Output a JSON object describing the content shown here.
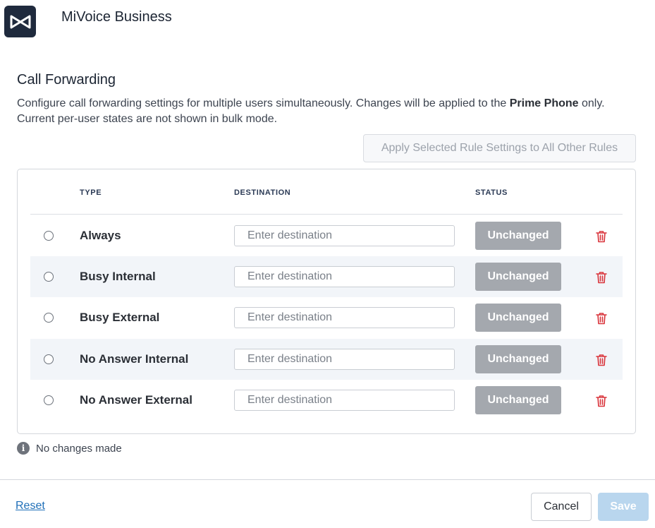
{
  "app": {
    "title": "MiVoice Business",
    "logo_icon": "mitel-logo-icon"
  },
  "section": {
    "title": "Call Forwarding",
    "description_part1": "Configure call forwarding settings for multiple users simultaneously. Changes will be applied to the ",
    "description_bold": "Prime Phone",
    "description_part2": " only. Current per-user states are not shown in bulk mode."
  },
  "apply_all_label": "Apply Selected Rule Settings to All Other Rules",
  "table": {
    "headers": {
      "type": "TYPE",
      "destination": "DESTINATION",
      "status": "STATUS"
    },
    "rows": [
      {
        "type": "Always",
        "destination_value": "",
        "destination_placeholder": "Enter destination",
        "status": "Unchanged"
      },
      {
        "type": "Busy Internal",
        "destination_value": "",
        "destination_placeholder": "Enter destination",
        "status": "Unchanged"
      },
      {
        "type": "Busy External",
        "destination_value": "",
        "destination_placeholder": "Enter destination",
        "status": "Unchanged"
      },
      {
        "type": "No Answer Internal",
        "destination_value": "",
        "destination_placeholder": "Enter destination",
        "status": "Unchanged"
      },
      {
        "type": "No Answer External",
        "destination_value": "",
        "destination_placeholder": "Enter destination",
        "status": "Unchanged"
      }
    ]
  },
  "info": {
    "icon": "info-icon",
    "text": "No changes made"
  },
  "footer": {
    "reset_label": "Reset",
    "cancel_label": "Cancel",
    "save_label": "Save"
  },
  "colors": {
    "badge": "#a4a8ae",
    "delete": "#d9343b",
    "link": "#1f6fb8",
    "save_disabled": "#b9d6ee",
    "row_alt": "#f2f5f9",
    "logo_bg": "#1f2a3d"
  }
}
